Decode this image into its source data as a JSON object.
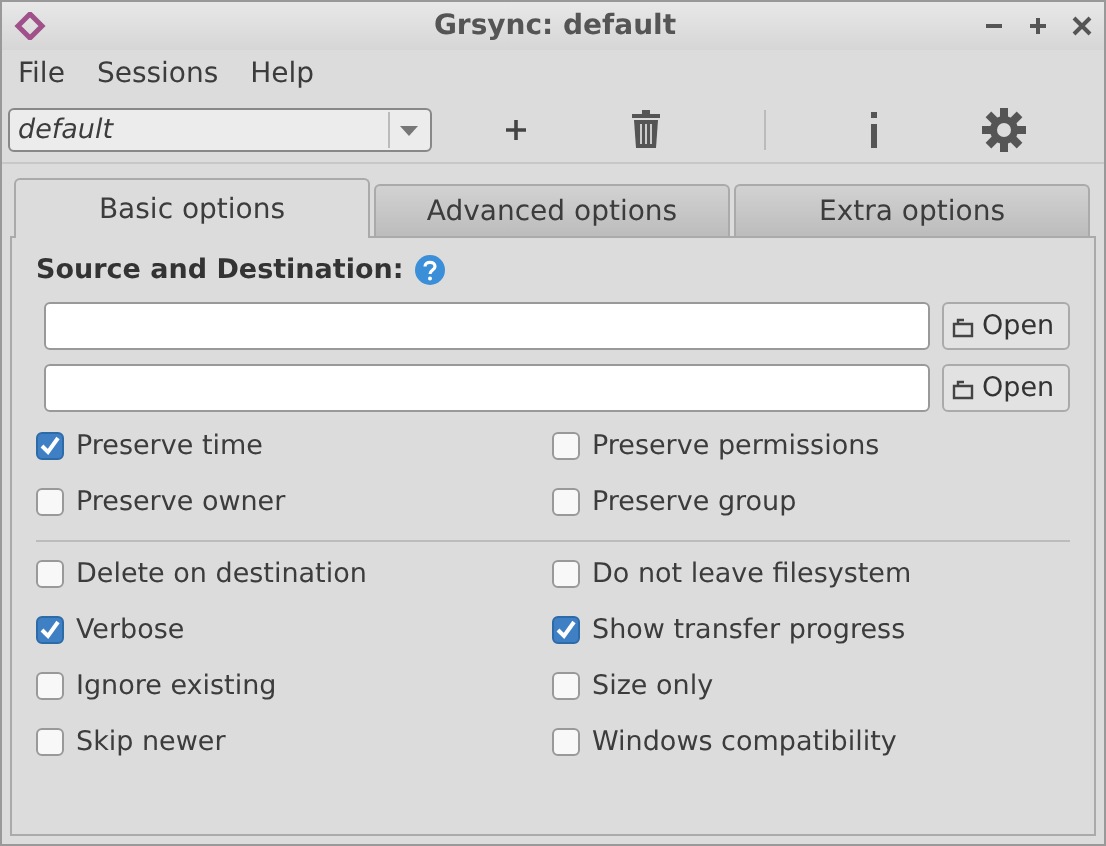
{
  "window": {
    "title": "Grsync: default"
  },
  "menu": [
    "File",
    "Sessions",
    "Help"
  ],
  "toolbar": {
    "session": "default"
  },
  "tabs": [
    {
      "label": "Basic options",
      "selected": true
    },
    {
      "label": "Advanced options",
      "selected": false
    },
    {
      "label": "Extra options",
      "selected": false
    }
  ],
  "section_title": "Source and Destination:",
  "paths": [
    {
      "button": "Open"
    },
    {
      "button": "Open"
    }
  ],
  "option_groups": [
    [
      {
        "label": "Preserve time",
        "checked": true
      },
      {
        "label": "Preserve permissions",
        "checked": false
      },
      {
        "label": "Preserve owner",
        "checked": false
      },
      {
        "label": "Preserve group",
        "checked": false
      }
    ],
    [
      {
        "label": "Delete on destination",
        "checked": false
      },
      {
        "label": "Do not leave filesystem",
        "checked": false
      },
      {
        "label": "Verbose",
        "checked": true
      },
      {
        "label": "Show transfer progress",
        "checked": true
      },
      {
        "label": "Ignore existing",
        "checked": false
      },
      {
        "label": "Size only",
        "checked": false
      },
      {
        "label": "Skip newer",
        "checked": false
      },
      {
        "label": "Windows compatibility",
        "checked": false
      }
    ]
  ]
}
